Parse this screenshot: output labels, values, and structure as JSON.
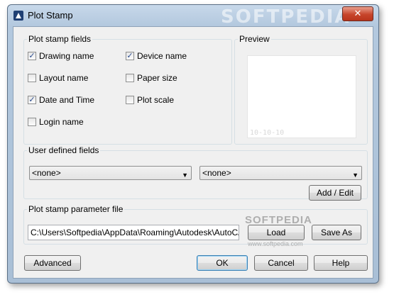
{
  "window": {
    "title": "Plot Stamp",
    "close_symbol": "✕",
    "watermark": "SOFTPEDIA"
  },
  "plot_stamp_fields": {
    "legend": "Plot stamp fields",
    "items": [
      {
        "label": "Drawing name",
        "checked": true
      },
      {
        "label": "Device name",
        "checked": true
      },
      {
        "label": "Layout name",
        "checked": false
      },
      {
        "label": "Paper size",
        "checked": false
      },
      {
        "label": "Date and Time",
        "checked": true
      },
      {
        "label": "Plot scale",
        "checked": false
      },
      {
        "label": "Login name",
        "checked": false
      }
    ]
  },
  "preview": {
    "legend": "Preview",
    "stamp_text": "10-10-10"
  },
  "user_defined": {
    "legend": "User defined fields",
    "combo1": "<none>",
    "combo2": "<none>",
    "add_edit_label": "Add / Edit"
  },
  "param_file": {
    "legend": "Plot stamp parameter file",
    "path": "C:\\Users\\Softpedia\\AppData\\Roaming\\Autodesk\\AutoCAD U",
    "load_label": "Load",
    "save_as_label": "Save As",
    "watermark_text": "SOFTPEDIA",
    "watermark_url": "www.softpedia.com"
  },
  "footer": {
    "advanced": "Advanced",
    "ok": "OK",
    "cancel": "Cancel",
    "help": "Help"
  }
}
